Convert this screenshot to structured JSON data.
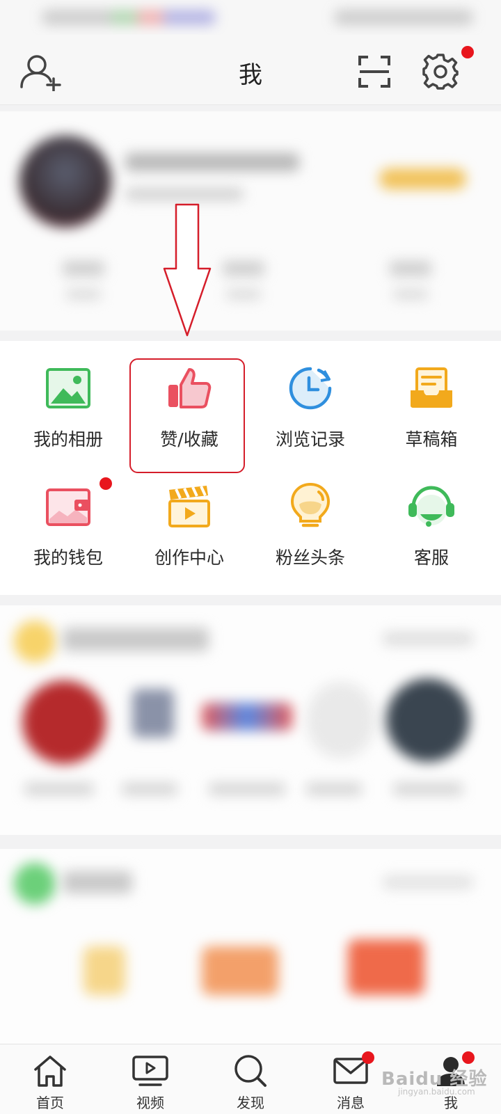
{
  "header": {
    "title": "我"
  },
  "features": [
    {
      "label": "我的相册",
      "icon": "photo-album-icon"
    },
    {
      "label": "赞/收藏",
      "icon": "thumbs-up-icon"
    },
    {
      "label": "浏览记录",
      "icon": "clock-history-icon"
    },
    {
      "label": "草稿箱",
      "icon": "drafts-tray-icon"
    },
    {
      "label": "我的钱包",
      "icon": "wallet-icon"
    },
    {
      "label": "创作中心",
      "icon": "clapperboard-icon"
    },
    {
      "label": "粉丝头条",
      "icon": "lightbulb-icon"
    },
    {
      "label": "客服",
      "icon": "headset-icon"
    }
  ],
  "nav": [
    {
      "label": "首页",
      "icon": "home-icon"
    },
    {
      "label": "视频",
      "icon": "video-icon"
    },
    {
      "label": "发现",
      "icon": "search-icon"
    },
    {
      "label": "消息",
      "icon": "mail-icon"
    },
    {
      "label": "我",
      "icon": "user-icon"
    }
  ],
  "watermark": {
    "brand": "Baidu 经验",
    "url": "jingyan.baidu.com"
  },
  "colors": {
    "accent_red": "#e8161d",
    "highlight_border": "#d51d2a"
  }
}
